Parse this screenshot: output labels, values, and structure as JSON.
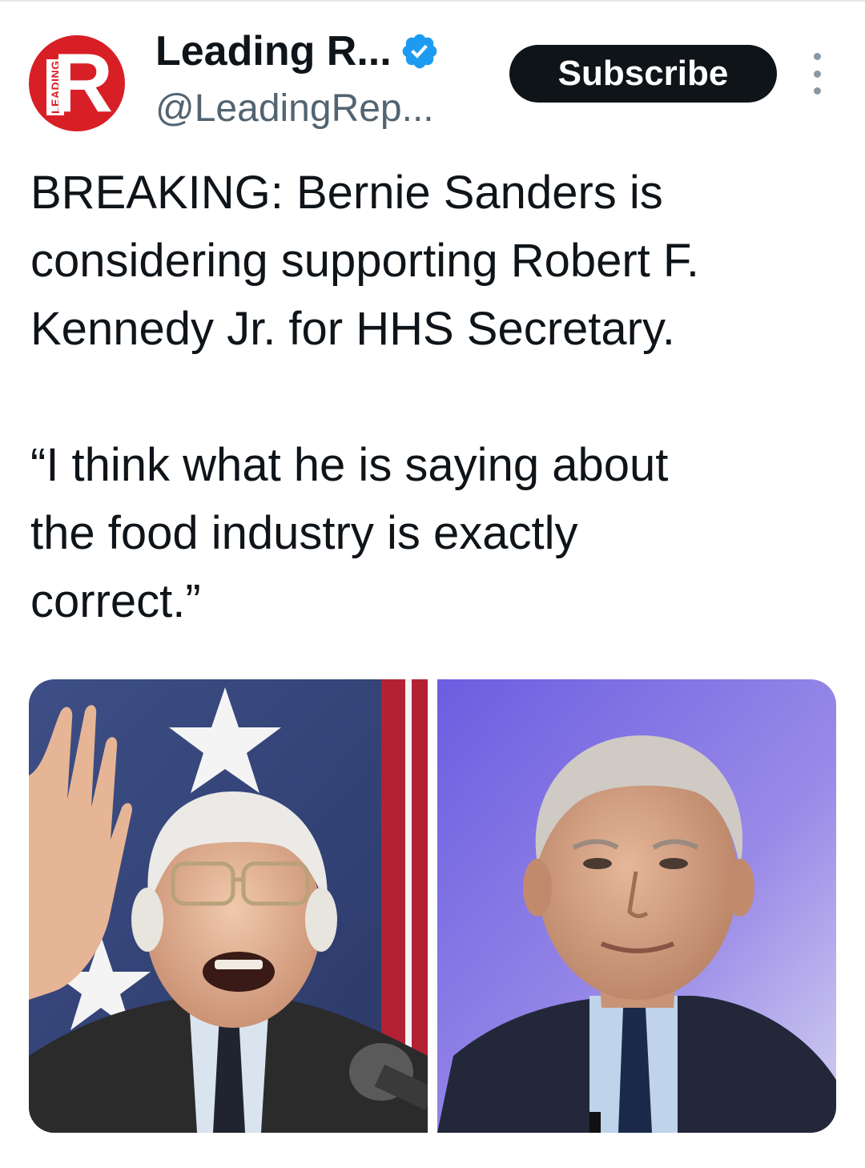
{
  "account": {
    "display_name": "Leading R...",
    "handle": "@LeadingRep...",
    "verified_icon": "verified-badge-icon",
    "avatar_letter": "R",
    "avatar_vertical_text": "LEADING",
    "avatar_color": "#d81f26",
    "verified_color": "#1d9bf0"
  },
  "header": {
    "subscribe_label": "Subscribe",
    "more_icon": "more-options-icon"
  },
  "tweet": {
    "paragraphs": [
      "BREAKING: Bernie Sanders is\nconsidering supporting Robert F.\nKennedy Jr. for HHS Secretary.",
      "“I think what he is saying about\nthe food industry is exactly\ncorrect.”"
    ]
  },
  "media": {
    "images": [
      {
        "subject": "bernie-sanders-photo"
      },
      {
        "subject": "robert-f-kennedy-jr-photo"
      }
    ]
  }
}
